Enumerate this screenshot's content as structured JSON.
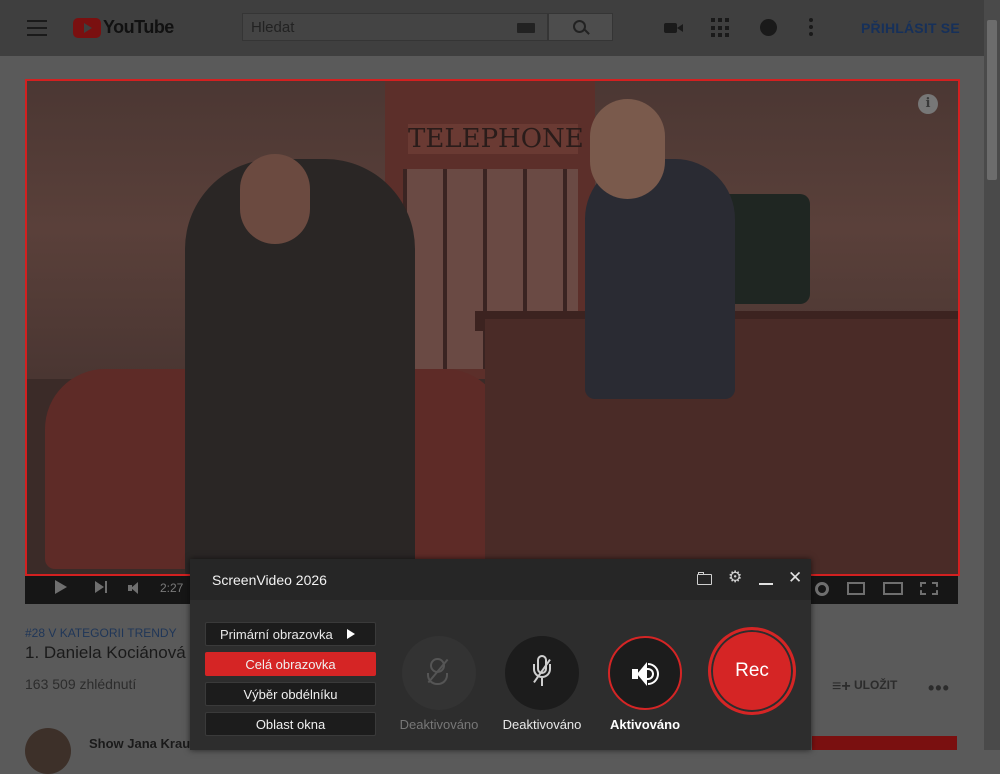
{
  "youtube": {
    "logo_text": "YouTube",
    "search": {
      "placeholder": "Hledat"
    },
    "sign_in_label": "PŘIHLÁSIT SE",
    "icons": [
      "menu-icon",
      "keyboard-icon",
      "search-icon",
      "video-camera-icon",
      "apps-icon",
      "messages-icon",
      "more-icon"
    ]
  },
  "video": {
    "sign_text": "TELEPHONE",
    "time_current": "2:27",
    "info_label": "i"
  },
  "below": {
    "trending_label": "#28 V KATEGORII TRENDY",
    "title": "1. Daniela Kociánová",
    "views": "163 509 zhlédnutí",
    "save_label": "ULOŽIT",
    "channel_name": "Show Jana Kraus"
  },
  "recorder": {
    "title": "ScreenVideo 2026",
    "modes": {
      "primary": "Primární obrazovka",
      "full": "Celá obrazovka",
      "rect": "Výběr obdélníku",
      "window": "Oblast okna"
    },
    "selected_mode": "Celá obrazovka",
    "webcam_label": "Deaktivováno",
    "mic_label": "Deaktivováno",
    "speaker_label": "Aktivováno",
    "rec_label": "Rec",
    "colors": {
      "accent": "#d52525",
      "panel": "#2d2d2d"
    }
  }
}
